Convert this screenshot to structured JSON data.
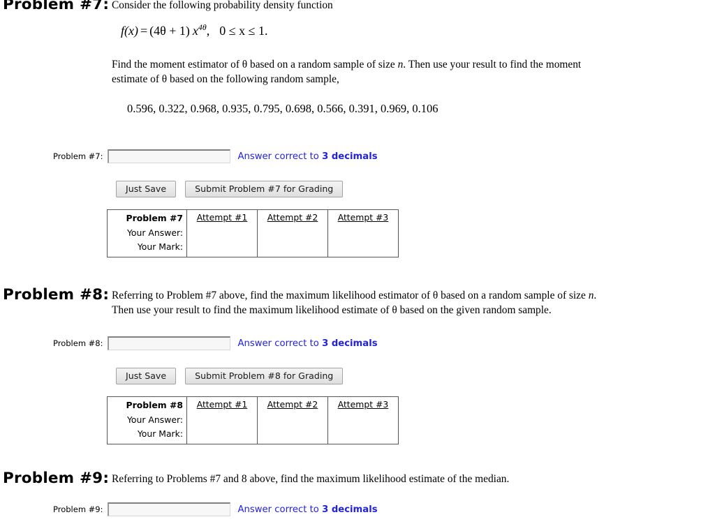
{
  "problem7": {
    "title": "Problem #7:",
    "intro": "Consider the following probability density function",
    "formula": {
      "lhs": "f(x)",
      "equals": "=",
      "coefficient": "(4θ + 1)",
      "base": "x",
      "exponent": "4θ",
      "comma": ",",
      "domain": "0 ≤ x ≤ 1."
    },
    "instructions_line1": "Find the moment estimator of θ based on a random sample of size n. Then use your result to find the moment",
    "instructions_line2": "estimate of θ based on the following random sample,",
    "sample": "0.596, 0.322, 0.968, 0.935, 0.795, 0.698, 0.566, 0.391, 0.969, 0.106",
    "answer_label": "Problem #7:",
    "answer_value": "",
    "answer_placeholder": "",
    "note_prefix": "Answer correct to ",
    "note_emphasis": "3 decimals",
    "save_button": "Just Save",
    "submit_button": "Submit Problem #7 for Grading",
    "table": {
      "row_header": "Problem #7",
      "row_labels": [
        "Your Answer:",
        "Your Mark:"
      ],
      "attempt_headers": [
        "Attempt #1",
        "Attempt #2",
        "Attempt #3"
      ],
      "answers": [
        "",
        "",
        ""
      ],
      "marks": [
        "",
        "",
        ""
      ]
    }
  },
  "problem8": {
    "title": "Problem #8:",
    "text_line1": "Referring to Problem #7 above, find the maximum likelihood estimator of θ based on a random sample of size n.",
    "text_line2": "Then use your result to find the maximum likelihood estimate of θ based on the given random sample.",
    "answer_label": "Problem #8:",
    "answer_value": "",
    "answer_placeholder": "",
    "note_prefix": "Answer correct to ",
    "note_emphasis": "3 decimals",
    "save_button": "Just Save",
    "submit_button": "Submit Problem #8 for Grading",
    "table": {
      "row_header": "Problem #8",
      "row_labels": [
        "Your Answer:",
        "Your Mark:"
      ],
      "attempt_headers": [
        "Attempt #1",
        "Attempt #2",
        "Attempt #3"
      ],
      "answers": [
        "",
        "",
        ""
      ],
      "marks": [
        "",
        "",
        ""
      ]
    }
  },
  "problem9": {
    "title": "Problem #9:",
    "text_line1": "Referring to Problems #7 and 8 above, find the maximum likelihood estimate of the median.",
    "answer_label": "Problem #9:",
    "answer_value": "",
    "answer_placeholder": "",
    "note_prefix": "Answer correct to ",
    "note_emphasis": "3 decimals"
  }
}
